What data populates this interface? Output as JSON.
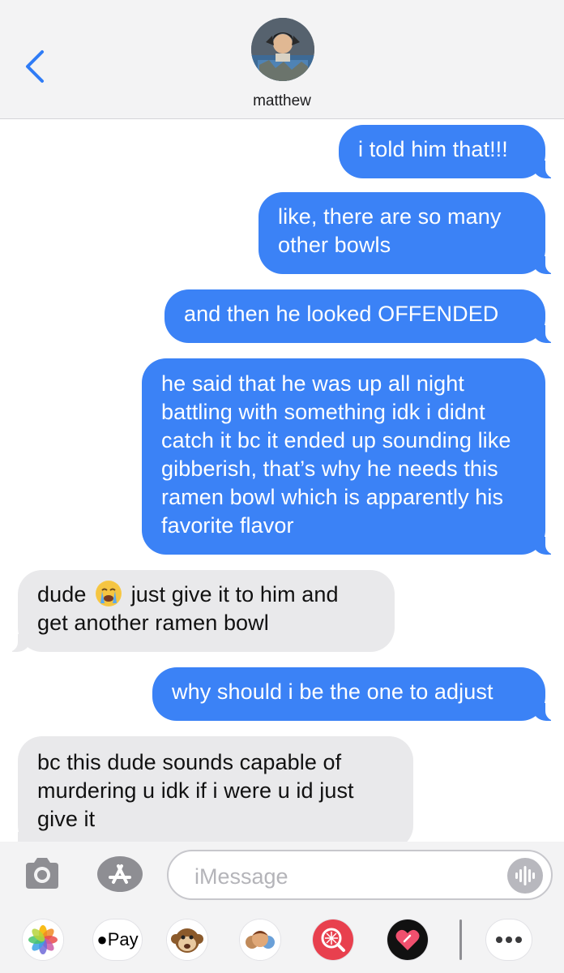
{
  "header": {
    "contact_name": "matthew"
  },
  "messages": [
    {
      "from": "me",
      "text": "i told him that!!!"
    },
    {
      "from": "me",
      "text": "like, there are so many other bowls"
    },
    {
      "from": "me",
      "text": "and then he looked OFFENDED"
    },
    {
      "from": "me",
      "text": "he said that he was up all night battling with something idk i didnt catch it bc it ended up sounding like gibberish, that’s why he needs this ramen bowl which is apparently his favorite flavor"
    },
    {
      "from": "them",
      "text_before_emoji": "dude",
      "emoji": "loudly-crying-face",
      "text_after_emoji": "just give it to him and get another ramen bowl"
    },
    {
      "from": "me",
      "text": "why should i be the one to adjust"
    },
    {
      "from": "them",
      "text": "bc this dude sounds capable of murdering u idk if i were u id just give it"
    }
  ],
  "input": {
    "placeholder": "iMessage",
    "value": ""
  },
  "drawer": {
    "apple_pay_label": "Pay"
  },
  "colors": {
    "sent_bubble": "#3b82f6",
    "received_bubble": "#e9e9eb",
    "accent": "#2f7cf6"
  },
  "icons": [
    "chevron-left-icon",
    "camera-icon",
    "app-store-icon",
    "audio-waveform-icon",
    "photos-icon",
    "apple-pay-icon",
    "animoji-monkey-icon",
    "memoji-icon",
    "search-images-icon",
    "digital-touch-icon",
    "more-icon"
  ]
}
